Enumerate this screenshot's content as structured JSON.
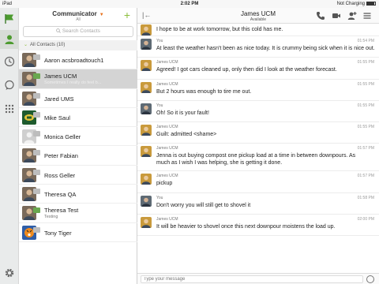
{
  "status_bar": {
    "device": "iPad",
    "time": "2:02 PM",
    "battery": "Not Charging"
  },
  "contacts_panel": {
    "title": "Communicator",
    "subtitle": "All",
    "search_placeholder": "Search Contacts",
    "group_label": "All Contacts (10)",
    "contacts": [
      {
        "name": "Aaron acsbroadtouch1",
        "status": "",
        "flag_color": "#bdbdbd",
        "avatar": "photo"
      },
      {
        "name": "James UCM",
        "status": "Sometimes I really do feel b...",
        "flag_color": "#6aa84f",
        "avatar": "photo",
        "selected": true
      },
      {
        "name": "Jared UMS",
        "status": "",
        "flag_color": "#bdbdbd",
        "avatar": "photo"
      },
      {
        "name": "Mike Saul",
        "status": "",
        "flag_color": "#bdbdbd",
        "avatar": "logo"
      },
      {
        "name": "Monica Geller",
        "status": "",
        "flag_color": "#bdbdbd",
        "avatar": "placeholder"
      },
      {
        "name": "Peter Fabian",
        "status": "",
        "flag_color": "#bdbdbd",
        "avatar": "photo"
      },
      {
        "name": "Ross Geller",
        "status": "",
        "flag_color": "#bdbdbd",
        "avatar": "photo"
      },
      {
        "name": "Theresa QA",
        "status": "",
        "flag_color": "#bdbdbd",
        "avatar": "photo"
      },
      {
        "name": "Theresa Test",
        "status": "Testing",
        "flag_color": "#6aa84f",
        "avatar": "photo"
      },
      {
        "name": "Tony Tiger",
        "status": "",
        "flag_color": "#bdbdbd",
        "avatar": "tiger"
      }
    ]
  },
  "chat": {
    "contact_name": "James UCM",
    "presence": "Available",
    "compose_placeholder": "Type your message",
    "messages": [
      {
        "sender": "",
        "time": "",
        "text": "I hope to be at work tomorrow, but this cold has me.",
        "avatar": "james",
        "first": true
      },
      {
        "sender": "You",
        "time": "01:54 PM",
        "text": "At least the weather hasn't been as nice today. It is crummy being sick when it is nice out.",
        "avatar": "you"
      },
      {
        "sender": "James UCM",
        "time": "01:55 PM",
        "text": "Agreed! I got cars cleaned up, only then did I look at the weather forecast.",
        "avatar": "james"
      },
      {
        "sender": "James UCM",
        "time": "01:55 PM",
        "text": "But 2 hours was enough to tire me out.",
        "avatar": "james"
      },
      {
        "sender": "You",
        "time": "01:55 PM",
        "text": "Oh! So it is your fault!",
        "avatar": "you"
      },
      {
        "sender": "James UCM",
        "time": "01:55 PM",
        "text": "Guilt: admitted <shame>",
        "avatar": "james"
      },
      {
        "sender": "James UCM",
        "time": "01:57 PM",
        "text": "Jenna is out buying compost one pickup load at a time in between downpours. As much as I wish I was helping, she is getting it done.",
        "avatar": "james",
        "tall": true
      },
      {
        "sender": "James UCM",
        "time": "01:57 PM",
        "text": "pickup",
        "avatar": "james"
      },
      {
        "sender": "You",
        "time": "01:58 PM",
        "text": "Don't worry you will still get to shovel it",
        "avatar": "you"
      },
      {
        "sender": "James UCM",
        "time": "02:00 PM",
        "text": "It will be heavier to shovel once this next downpour moistens the load up.",
        "avatar": "james"
      }
    ]
  },
  "colors": {
    "accent_green": "#8cbf3c",
    "accent_orange": "#e7701a",
    "sidebar_bg": "#e9ebeb"
  }
}
